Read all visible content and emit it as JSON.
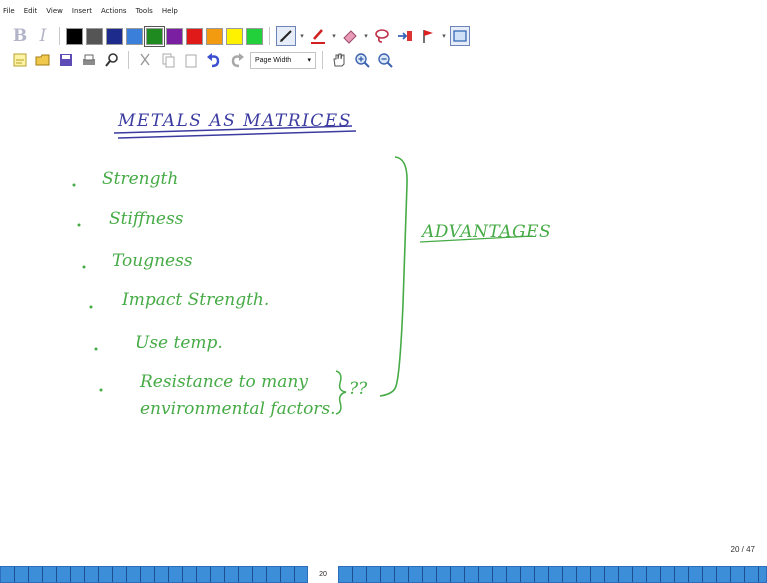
{
  "menu": [
    "File",
    "Edit",
    "View",
    "Insert",
    "Actions",
    "Tools",
    "Help"
  ],
  "toolbar": {
    "bold_label": "B",
    "italic_label": "I",
    "color_swatches": [
      "#000000",
      "#555555",
      "#1c2b8c",
      "#3a7fd9",
      "#1f8a1f",
      "#7b1fa2",
      "#e01919",
      "#f29a10",
      "#fff200",
      "#22d03b"
    ],
    "selected_swatch": "#1f8a1f",
    "tool_icons": [
      "pen-icon",
      "highlighter-icon",
      "eraser-icon",
      "lasso-icon",
      "insert-space-icon",
      "flag-icon",
      "select-rectangle-icon"
    ],
    "file_icons": [
      "new-note-icon",
      "open-icon",
      "save-icon",
      "print-icon",
      "find-icon",
      "cut-icon",
      "copy-icon",
      "paste-icon",
      "undo-icon",
      "redo-icon"
    ],
    "zoom_select": "Page Width",
    "view_icons": [
      "pan-hand-icon",
      "zoom-in-icon",
      "zoom-out-icon"
    ]
  },
  "note": {
    "title": "METALS AS MATRICES",
    "bullets": [
      "Strength",
      "Stiffness",
      "Tougness",
      "Impact Strength.",
      "Use temp.",
      "Resistance to many",
      "environmental factors."
    ],
    "question_marks": "??",
    "group_label": "ADVANTAGES",
    "ink_color": "#46ab46",
    "title_color": "#3b3ba0"
  },
  "page_counter": "20 / 47",
  "slider": {
    "current_page": "20"
  }
}
